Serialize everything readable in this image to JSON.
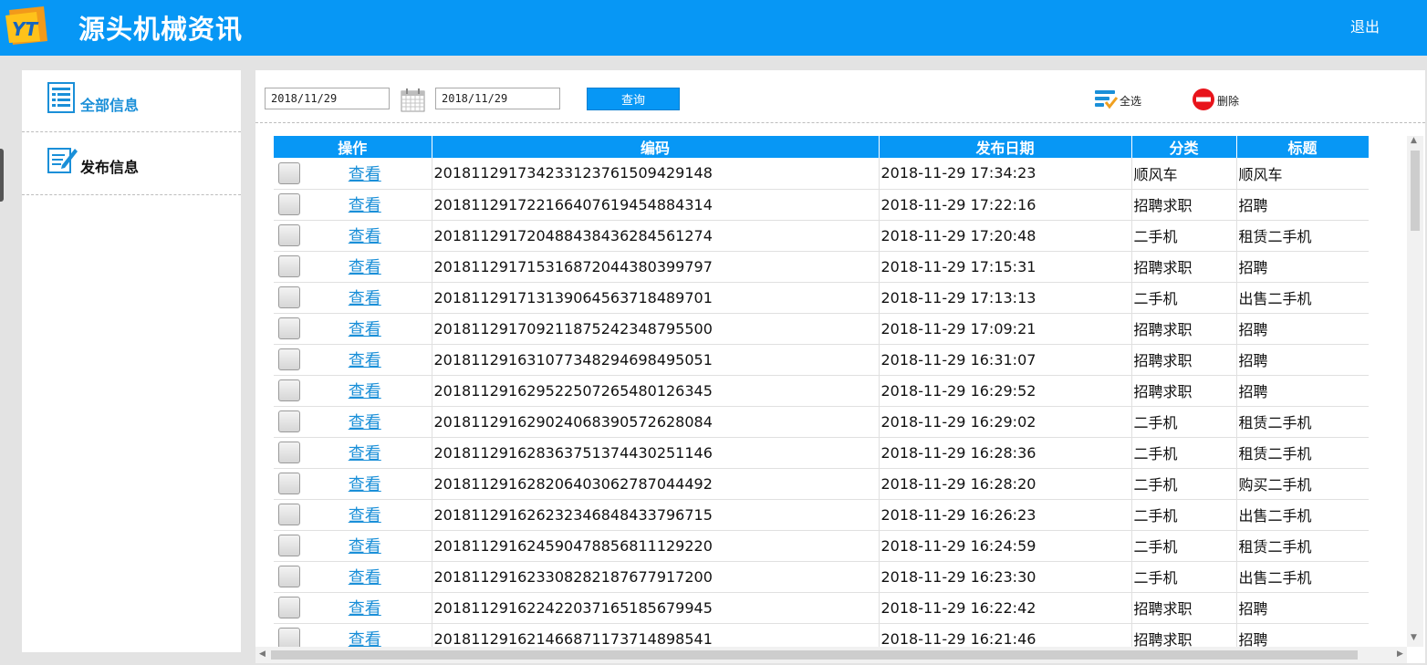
{
  "app": {
    "title": "源头机械资讯",
    "logo_text": "YT",
    "logout": "退出"
  },
  "sidebar": {
    "items": [
      {
        "label": "全部信息",
        "icon": "list-document-icon"
      },
      {
        "label": "发布信息",
        "icon": "edit-document-icon"
      }
    ]
  },
  "toolbar": {
    "date_from": "2018/11/29",
    "date_to": "2018/11/29",
    "query_label": "查询",
    "select_all_label": "全选",
    "delete_label": "删除"
  },
  "table": {
    "columns": [
      "操作",
      "编码",
      "发布日期",
      "分类",
      "标题"
    ],
    "view_label": "查看",
    "rows": [
      {
        "code": "20181129173423312376150942914​8",
        "date": "2018-11-29 17:34:23",
        "category": "顺风车",
        "title": "顺风车"
      },
      {
        "code": "201811291722166407619454884314",
        "date": "2018-11-29 17:22:16",
        "category": "招聘求职",
        "title": "招聘"
      },
      {
        "code": "201811291720488438436284561274",
        "date": "2018-11-29 17:20:48",
        "category": "二手机",
        "title": "租赁二手机"
      },
      {
        "code": "201811291715316872044380399797",
        "date": "2018-11-29 17:15:31",
        "category": "招聘求职",
        "title": "招聘"
      },
      {
        "code": "201811291713139064563718489701",
        "date": "2018-11-29 17:13:13",
        "category": "二手机",
        "title": "出售二手机"
      },
      {
        "code": "201811291709211875242348795500",
        "date": "2018-11-29 17:09:21",
        "category": "招聘求职",
        "title": "招聘"
      },
      {
        "code": "201811291631077348294698495051",
        "date": "2018-11-29 16:31:07",
        "category": "招聘求职",
        "title": "招聘"
      },
      {
        "code": "201811291629522507265480126345",
        "date": "2018-11-29 16:29:52",
        "category": "招聘求职",
        "title": "招聘"
      },
      {
        "code": "201811291629024068390572628084",
        "date": "2018-11-29 16:29:02",
        "category": "二手机",
        "title": "租赁二手机"
      },
      {
        "code": "201811291628363751374430251146",
        "date": "2018-11-29 16:28:36",
        "category": "二手机",
        "title": "租赁二手机"
      },
      {
        "code": "201811291628206403062787044492",
        "date": "2018-11-29 16:28:20",
        "category": "二手机",
        "title": "购买二手机"
      },
      {
        "code": "201811291626232346848433796715",
        "date": "2018-11-29 16:26:23",
        "category": "二手机",
        "title": "出售二手机"
      },
      {
        "code": "201811291624590478856811129220",
        "date": "2018-11-29 16:24:59",
        "category": "二手机",
        "title": "租赁二手机"
      },
      {
        "code": "201811291623308282187677917200",
        "date": "2018-11-29 16:23:30",
        "category": "二手机",
        "title": "出售二手机"
      },
      {
        "code": "201811291622422037165185679945",
        "date": "2018-11-29 16:22:42",
        "category": "招聘求职",
        "title": "招聘"
      },
      {
        "code": "201811291621466871173714898541",
        "date": "2018-11-29 16:21:46",
        "category": "招聘求职",
        "title": "招聘"
      }
    ]
  }
}
